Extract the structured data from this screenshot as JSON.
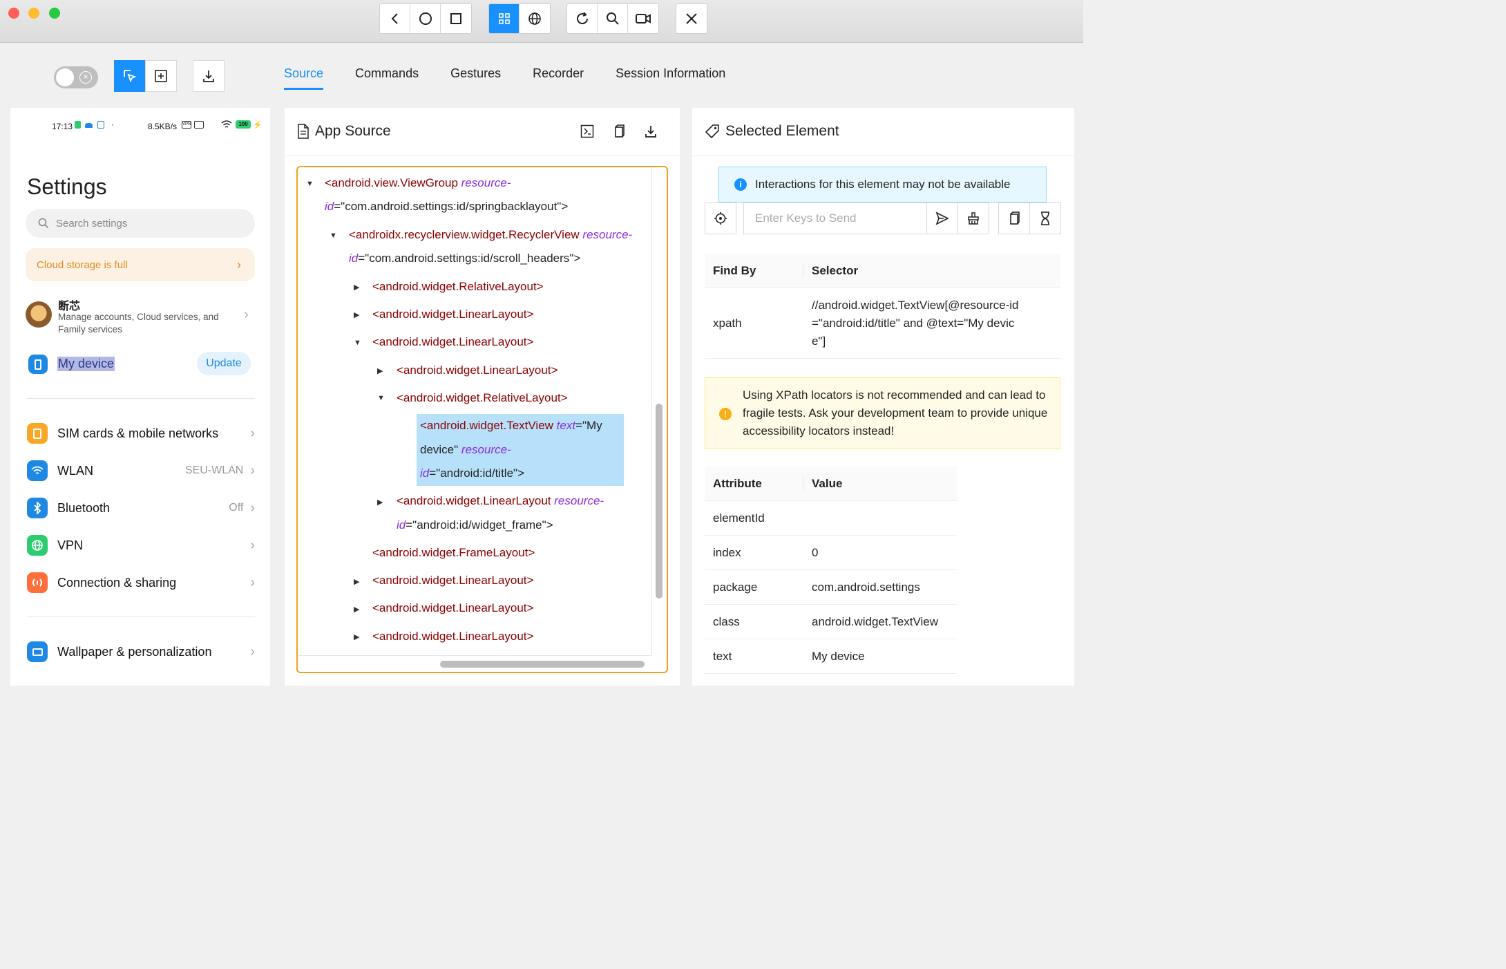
{
  "window": {
    "traffic_colors": [
      "#ff5f57",
      "#febc2e",
      "#28c840"
    ]
  },
  "toolbar_icons": [
    "back-icon",
    "home-icon",
    "app-switch-icon",
    "grid-icon",
    "globe-icon",
    "refresh-icon",
    "search-icon",
    "video-icon",
    "close-icon"
  ],
  "tabs": [
    "Source",
    "Commands",
    "Gestures",
    "Recorder",
    "Session Information"
  ],
  "phone": {
    "time": "17:13",
    "net": "8.5KB/s",
    "battery": "100",
    "title": "Settings",
    "search_placeholder": "Search settings",
    "cloud_notice": "Cloud storage is full",
    "account_name": "断芯",
    "account_desc": "Manage accounts, Cloud services, and Family services",
    "my_device": "My device",
    "update": "Update",
    "rows": [
      {
        "label": "SIM cards & mobile networks",
        "value": "",
        "color": "#f9a825"
      },
      {
        "label": "WLAN",
        "value": "SEU-WLAN",
        "color": "#1e88e5"
      },
      {
        "label": "Bluetooth",
        "value": "Off",
        "color": "#1e88e5"
      },
      {
        "label": "VPN",
        "value": "",
        "color": "#2ecc71"
      },
      {
        "label": "Connection & sharing",
        "value": "",
        "color": "#ff6f3c"
      },
      {
        "label": "Wallpaper & personalization",
        "value": "",
        "color": "#1e88e5"
      }
    ]
  },
  "app_source": {
    "title": "App Source",
    "lines": [
      {
        "tag": "<android.view.ViewGroup",
        "attr": " resource-",
        "rest": ""
      },
      {
        "tag": "",
        "attr": "id",
        "rest": "=\"com.android.settings:id/springbacklayout\">"
      },
      {
        "tag": "<androidx.recyclerview.widget.RecyclerView",
        "attr": " resource-",
        "rest": ""
      },
      {
        "tag": "",
        "attr": "id",
        "rest": "=\"com.android.settings:id/scroll_headers\">"
      },
      {
        "tag": "<android.widget.RelativeLayout>",
        "attr": "",
        "rest": ""
      },
      {
        "tag": "<android.widget.LinearLayout>",
        "attr": "",
        "rest": ""
      },
      {
        "tag": "<android.widget.LinearLayout>",
        "attr": "",
        "rest": ""
      },
      {
        "tag": "<android.widget.LinearLayout>",
        "attr": "",
        "rest": ""
      },
      {
        "tag": "<android.widget.RelativeLayout>",
        "attr": "",
        "rest": ""
      },
      {
        "tag": "<android.widget.TextView",
        "attr": " text",
        "rest": "=\"My"
      },
      {
        "tag": "",
        "attr": "",
        "rest": "device\""
      },
      {
        "tag": "",
        "attr": "resource-",
        "rest": ""
      },
      {
        "tag": "",
        "attr": "id",
        "rest": "=\"android:id/title\">"
      },
      {
        "tag": "<android.widget.LinearLayout",
        "attr": " resource-",
        "rest": ""
      },
      {
        "tag": "",
        "attr": "id",
        "rest": "=\"android:id/widget_frame\">"
      },
      {
        "tag": "<android.widget.FrameLayout>",
        "attr": "",
        "rest": ""
      },
      {
        "tag": "<android.widget.LinearLayout>",
        "attr": "",
        "rest": ""
      },
      {
        "tag": "<android.widget.LinearLayout>",
        "attr": "",
        "rest": ""
      },
      {
        "tag": "<android.widget.LinearLayout>",
        "attr": "",
        "rest": ""
      }
    ]
  },
  "selected": {
    "title": "Selected Element",
    "info": "Interactions for this element may not be available",
    "keys_placeholder": "Enter Keys to Send",
    "findby_header": "Find By",
    "selector_header": "Selector",
    "findby": "xpath",
    "selector_lines": [
      "//android.widget.TextView[@resource-id",
      "=\"android:id/title\" and @text=\"My devic",
      "e\"]"
    ],
    "warning": "Using XPath locators is not recommended and can lead to fragile tests. Ask your development team to provide unique accessibility locators instead!",
    "attr_header": "Attribute",
    "value_header": "Value",
    "attributes": [
      {
        "name": "elementId",
        "value": ""
      },
      {
        "name": "index",
        "value": "0"
      },
      {
        "name": "package",
        "value": "com.android.settings"
      },
      {
        "name": "class",
        "value": "android.widget.TextView"
      },
      {
        "name": "text",
        "value": "My device"
      }
    ]
  }
}
